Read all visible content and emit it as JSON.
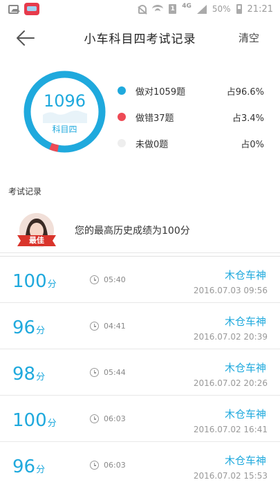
{
  "status_bar": {
    "network": "4G",
    "battery": "50%",
    "time": "21:21"
  },
  "header": {
    "title": "小车科目四考试记录",
    "clear_label": "清空"
  },
  "summary": {
    "total": "1096",
    "subject": "科目四",
    "correct_fraction": 0.966,
    "wrong_fraction": 0.034,
    "stats": [
      {
        "label": "做对1059题",
        "percent": "占96.6%",
        "color": "#1fa9dd"
      },
      {
        "label": "做错37题",
        "percent": "占3.4%",
        "color": "#ee4a55"
      },
      {
        "label": "未做0题",
        "percent": "占0%",
        "color": "#eeeeee"
      }
    ]
  },
  "records_section": {
    "title": "考试记录",
    "best_badge": "最佳",
    "best_text": "您的最高历史成绩为100分"
  },
  "records": [
    {
      "score": "100",
      "unit": "分",
      "duration": "05:40",
      "title": "木仓车神",
      "date": "2016.07.03 09:56"
    },
    {
      "score": "96",
      "unit": "分",
      "duration": "04:41",
      "title": "木仓车神",
      "date": "2016.07.02 20:39"
    },
    {
      "score": "98",
      "unit": "分",
      "duration": "05:44",
      "title": "木仓车神",
      "date": "2016.07.02 20:26"
    },
    {
      "score": "100",
      "unit": "分",
      "duration": "06:03",
      "title": "木仓车神",
      "date": "2016.07.02 16:41"
    },
    {
      "score": "96",
      "unit": "分",
      "duration": "06:03",
      "title": "木仓车神",
      "date": "2016.07.02 15:53"
    }
  ]
}
